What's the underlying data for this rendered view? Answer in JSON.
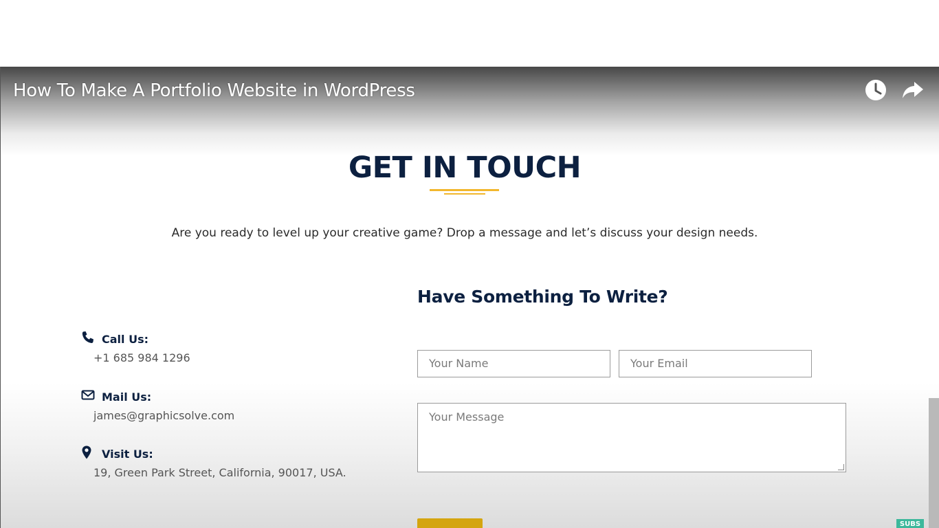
{
  "video": {
    "title": "How To Make A Portfolio Website in WordPress",
    "watch_later_icon": "clock-icon",
    "share_icon": "share-arrow-icon"
  },
  "section": {
    "heading": "GET IN TOUCH",
    "intro": "Are you ready to level up your creative game? Drop a message and let’s discuss your design needs.",
    "accent_color": "#f2b72d",
    "heading_color": "#0c2040"
  },
  "contact": {
    "call": {
      "icon": "phone-icon",
      "label": "Call Us:",
      "value": "+1 685 984 1296"
    },
    "mail": {
      "icon": "envelope-icon",
      "label": "Mail Us:",
      "value": "james@graphicsolve.com"
    },
    "visit": {
      "icon": "map-pin-icon",
      "label": "Visit Us:",
      "value": "19, Green Park Street, California, 90017, USA."
    }
  },
  "form": {
    "title": "Have Something To Write?",
    "name_placeholder": "Your Name",
    "email_placeholder": "Your Email",
    "message_placeholder": "Your Message",
    "submit_color": "#d4a50f"
  },
  "badge": {
    "label": "SUBS",
    "color": "#3cb89b"
  }
}
